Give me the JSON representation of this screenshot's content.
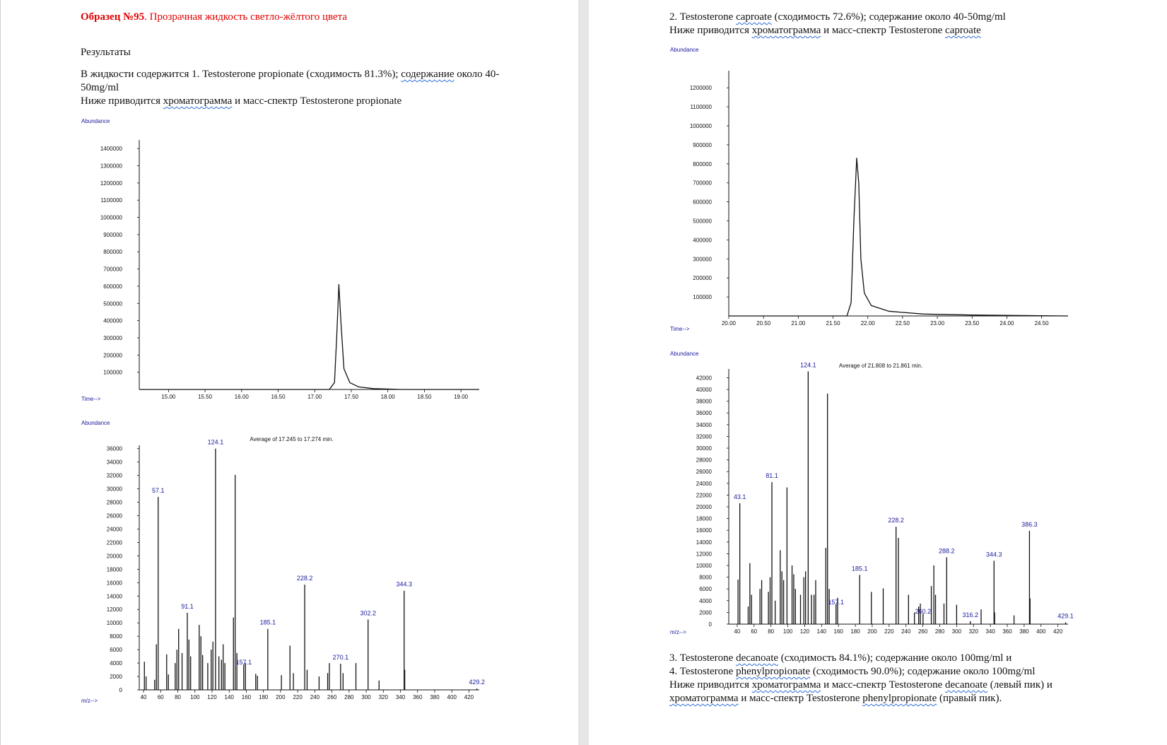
{
  "left_page": {
    "title_bold": "Образец №95",
    "title_rest": ". Прозрачная жидкость светло-жёлтого цвета",
    "results_heading": "Результаты",
    "p1_part1": "В жидкости содержится 1. Testosterone propionate (сходимость 81.3%); ",
    "p1_part2": "содержание",
    "p1_part3": " около 40-",
    "p1_line2": "50mg/ml",
    "p2_part1": "Ниже приводится ",
    "p2_part2": "хроматограмма",
    "p2_part3": " и масс-спектр Testosterone propionate"
  },
  "right_page": {
    "p1_part1": "2. Testosterone ",
    "p1_part2": "caproate",
    "p1_part3": " (сходимость 72.6%); содержание около 40-50mg/ml",
    "p2_part1": "Ниже приводится ",
    "p2_part2": "хроматограмма",
    "p2_part3": " и масс-спектр Testosterone ",
    "p2_part4": "caproate",
    "p3_line1_a": "3. Testosterone ",
    "p3_line1_b": "decanoate",
    "p3_line1_c": " (сходимость 84.1%); содержание около 100mg/ml и",
    "p3_line2_a": "4. Testosterone ",
    "p3_line2_b": "phenylpropionate",
    "p3_line2_c": " (сходимость 90.0%); содержание около 100mg/ml",
    "p3_line3_a": "Ниже приводится ",
    "p3_line3_b": "хроматограмма",
    "p3_line3_c": " и масс-спектр Testosterone ",
    "p3_line3_d": "decanoate",
    "p3_line3_e": " (левый пик) и",
    "p3_line4_a": "хроматограмма",
    "p3_line4_b": " и масс-спектр Testosterone ",
    "p3_line4_c": "phenylpropionate",
    "p3_line4_d": " (правый пик)."
  },
  "chart_data": [
    {
      "id": "chrom-left",
      "type": "line",
      "ylabel": "Abundance",
      "xlabel": "Time-->",
      "xlim": [
        14.6,
        19.25
      ],
      "ylim": [
        0,
        1450000
      ],
      "x_ticks": [
        "15.00",
        "15.50",
        "16.00",
        "16.50",
        "17.00",
        "17.50",
        "18.00",
        "18.50",
        "19.00"
      ],
      "y_ticks": [
        "100000",
        "200000",
        "300000",
        "400000",
        "500000",
        "600000",
        "700000",
        "800000",
        "900000",
        "1000000",
        "1100000",
        "1200000",
        "1300000",
        "1400000"
      ],
      "series": [
        {
          "x": [
            14.6,
            17.2,
            17.27,
            17.3,
            17.33,
            17.36,
            17.4,
            17.48,
            17.6,
            17.8,
            18.2,
            19.25
          ],
          "y": [
            0,
            0,
            40000,
            300000,
            610000,
            380000,
            120000,
            40000,
            15000,
            5000,
            0,
            0
          ]
        }
      ]
    },
    {
      "id": "ms-left",
      "type": "bar",
      "ylabel": "Abundance",
      "xlabel": "m/z-->",
      "annotation": "Average of 17.245 to 17.274 min.",
      "xlim": [
        35,
        432
      ],
      "ylim": [
        0,
        36500
      ],
      "x_ticks": [
        "40",
        "60",
        "80",
        "100",
        "120",
        "140",
        "160",
        "180",
        "200",
        "220",
        "240",
        "260",
        "280",
        "300",
        "320",
        "340",
        "360",
        "380",
        "400",
        "420"
      ],
      "y_ticks": [
        "0",
        "2000",
        "4000",
        "6000",
        "8000",
        "10000",
        "12000",
        "14000",
        "16000",
        "18000",
        "20000",
        "22000",
        "24000",
        "26000",
        "28000",
        "30000",
        "32000",
        "34000",
        "36000"
      ],
      "peaks": [
        [
          41,
          4200
        ],
        [
          43,
          2000
        ],
        [
          53,
          1500
        ],
        [
          55,
          6800
        ],
        [
          57.1,
          28800
        ],
        [
          67,
          5300
        ],
        [
          69,
          2300
        ],
        [
          77,
          4000
        ],
        [
          79,
          6000
        ],
        [
          81,
          9100
        ],
        [
          85,
          5500
        ],
        [
          91.1,
          11500
        ],
        [
          93,
          7500
        ],
        [
          95,
          5000
        ],
        [
          105,
          9700
        ],
        [
          107,
          8000
        ],
        [
          109,
          5200
        ],
        [
          115,
          4000
        ],
        [
          119,
          6000
        ],
        [
          121,
          7200
        ],
        [
          124.1,
          36000
        ],
        [
          128,
          5000
        ],
        [
          131,
          4500
        ],
        [
          133,
          6800
        ],
        [
          135,
          4000
        ],
        [
          145,
          10800
        ],
        [
          147,
          32100
        ],
        [
          149,
          5500
        ],
        [
          157,
          3800
        ],
        [
          159,
          4000
        ],
        [
          171,
          2400
        ],
        [
          173,
          2100
        ],
        [
          185.1,
          9100
        ],
        [
          201,
          2200
        ],
        [
          211,
          6600
        ],
        [
          215,
          2500
        ],
        [
          228.2,
          15700
        ],
        [
          231,
          3000
        ],
        [
          245,
          2000
        ],
        [
          255,
          2500
        ],
        [
          257,
          4000
        ],
        [
          270.1,
          3900
        ],
        [
          273,
          2500
        ],
        [
          288,
          4000
        ],
        [
          302.2,
          10500
        ],
        [
          315,
          1400
        ],
        [
          344.3,
          14800
        ],
        [
          345,
          3000
        ],
        [
          429.2,
          200
        ]
      ],
      "labels": [
        {
          "mz": "57.1"
        },
        {
          "mz": "91.1"
        },
        {
          "mz": "124.1"
        },
        {
          "mz": "157.1"
        },
        {
          "mz": "185.1"
        },
        {
          "mz": "228.2"
        },
        {
          "mz": "270.1"
        },
        {
          "mz": "302.2"
        },
        {
          "mz": "344.3"
        },
        {
          "mz": "429.2"
        }
      ]
    },
    {
      "id": "chrom-right",
      "type": "line",
      "ylabel": "Abundance",
      "xlabel": "Time-->",
      "xlim": [
        20.0,
        24.88
      ],
      "ylim": [
        0,
        1290000
      ],
      "x_ticks": [
        "20.00",
        "20.50",
        "21.00",
        "21.50",
        "22.00",
        "22.50",
        "23.00",
        "23.50",
        "24.00",
        "24.50"
      ],
      "y_ticks": [
        "100000",
        "200000",
        "300000",
        "400000",
        "500000",
        "600000",
        "700000",
        "800000",
        "900000",
        "1000000",
        "1100000",
        "1200000"
      ],
      "series": [
        {
          "x": [
            20.0,
            21.7,
            21.76,
            21.8,
            21.84,
            21.87,
            21.9,
            21.95,
            22.05,
            22.3,
            22.8,
            23.5,
            24.88
          ],
          "y": [
            0,
            0,
            70000,
            500000,
            830000,
            700000,
            300000,
            120000,
            55000,
            25000,
            10000,
            5000,
            0
          ]
        }
      ]
    },
    {
      "id": "ms-right",
      "type": "bar",
      "ylabel": "Abundance",
      "xlabel": "m/z-->",
      "annotation": "Average of 21.808 to 21.861 min.",
      "xlim": [
        30,
        432
      ],
      "ylim": [
        0,
        43500
      ],
      "x_ticks": [
        "40",
        "60",
        "80",
        "100",
        "120",
        "140",
        "160",
        "180",
        "200",
        "220",
        "240",
        "260",
        "280",
        "300",
        "320",
        "340",
        "360",
        "380",
        "400",
        "420"
      ],
      "y_ticks": [
        "0",
        "2000",
        "4000",
        "6000",
        "8000",
        "10000",
        "12000",
        "14000",
        "16000",
        "18000",
        "20000",
        "22000",
        "24000",
        "26000",
        "28000",
        "30000",
        "32000",
        "34000",
        "36000",
        "38000",
        "40000",
        "42000"
      ],
      "peaks": [
        [
          41,
          7600
        ],
        [
          43.1,
          20600
        ],
        [
          53,
          3000
        ],
        [
          55,
          10400
        ],
        [
          57,
          5000
        ],
        [
          67,
          6000
        ],
        [
          69,
          7500
        ],
        [
          77,
          5500
        ],
        [
          79,
          8000
        ],
        [
          81.1,
          24200
        ],
        [
          85,
          4000
        ],
        [
          91,
          12600
        ],
        [
          93,
          9000
        ],
        [
          95,
          7500
        ],
        [
          99,
          23300
        ],
        [
          105,
          10000
        ],
        [
          107,
          8500
        ],
        [
          109,
          6000
        ],
        [
          115,
          5000
        ],
        [
          119,
          8000
        ],
        [
          121,
          9000
        ],
        [
          124.1,
          43100
        ],
        [
          128,
          5000
        ],
        [
          131,
          5000
        ],
        [
          133,
          7500
        ],
        [
          145,
          13000
        ],
        [
          147,
          39300
        ],
        [
          149,
          6000
        ],
        [
          157.1,
          3400
        ],
        [
          159,
          4500
        ],
        [
          185.1,
          8400
        ],
        [
          199,
          5500
        ],
        [
          213,
          6100
        ],
        [
          228.2,
          16600
        ],
        [
          231,
          14700
        ],
        [
          243,
          5000
        ],
        [
          250,
          2000
        ],
        [
          255,
          3000
        ],
        [
          257,
          3500
        ],
        [
          260.2,
          1800
        ],
        [
          270,
          6500
        ],
        [
          273,
          10000
        ],
        [
          275,
          5000
        ],
        [
          285,
          3500
        ],
        [
          288.2,
          11400
        ],
        [
          300,
          3300
        ],
        [
          316.2,
          500
        ],
        [
          329,
          2500
        ],
        [
          344.3,
          10800
        ],
        [
          345,
          2000
        ],
        [
          368,
          1500
        ],
        [
          386.3,
          15900
        ],
        [
          387,
          4400
        ],
        [
          429.1,
          300
        ]
      ],
      "labels": [
        {
          "mz": "43.1"
        },
        {
          "mz": "81.1"
        },
        {
          "mz": "124.1"
        },
        {
          "mz": "157.1"
        },
        {
          "mz": "185.1"
        },
        {
          "mz": "228.2"
        },
        {
          "mz": "260.2"
        },
        {
          "mz": "288.2"
        },
        {
          "mz": "316.2"
        },
        {
          "mz": "344.3"
        },
        {
          "mz": "386.3"
        },
        {
          "mz": "429.1"
        }
      ]
    }
  ]
}
